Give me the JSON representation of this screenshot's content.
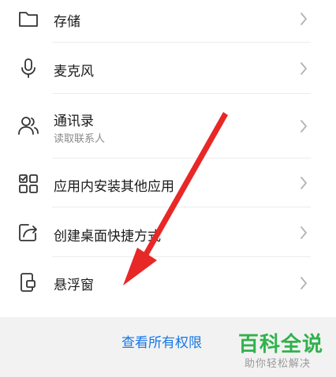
{
  "permissions": [
    {
      "key": "storage",
      "title": "存储",
      "icon": "folder-icon"
    },
    {
      "key": "microphone",
      "title": "麦克风",
      "icon": "microphone-icon"
    },
    {
      "key": "contacts",
      "title": "通讯录",
      "subtitle": "读取联系人",
      "icon": "contacts-icon"
    },
    {
      "key": "install-apps",
      "title": "应用内安装其他应用",
      "icon": "apps-grid-icon"
    },
    {
      "key": "desktop-shortcut",
      "title": "创建桌面快捷方式",
      "icon": "shortcut-icon"
    },
    {
      "key": "floating-window",
      "title": "悬浮窗",
      "icon": "floating-window-icon"
    }
  ],
  "footer": {
    "view_all_label": "查看所有权限"
  },
  "watermark": {
    "title": "百科全说",
    "subtitle": "助你轻松解决"
  },
  "colors": {
    "accent": "#1677e6",
    "annotation_arrow": "#e82727",
    "watermark_green": "#2fb24b"
  }
}
